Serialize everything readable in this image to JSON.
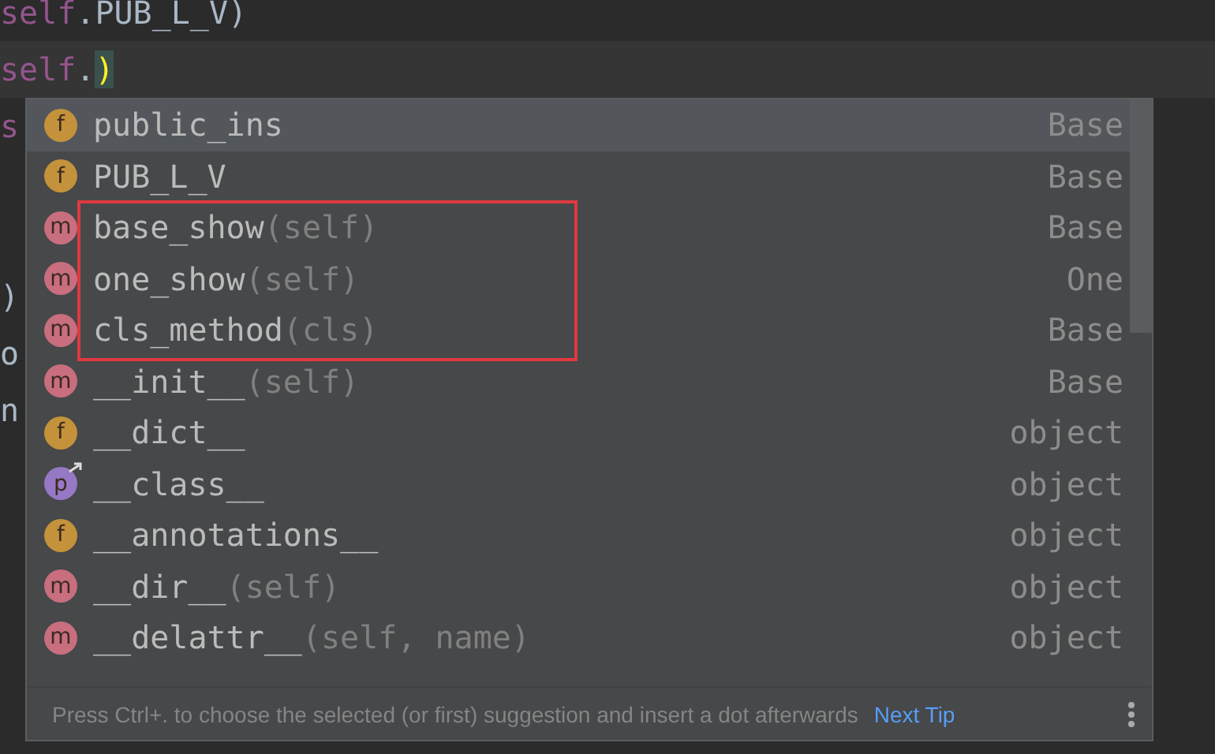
{
  "editor_lines": [
    {
      "segments": [
        {
          "kind": "keyword",
          "text": "self"
        },
        {
          "kind": "plain",
          "text": ".PUB_L_V)"
        }
      ]
    },
    {
      "current": true,
      "segments": [
        {
          "kind": "keyword",
          "text": "self"
        },
        {
          "kind": "plain",
          "text": "."
        },
        {
          "kind": "bracket",
          "text": ")"
        }
      ]
    },
    {
      "segments": [
        {
          "kind": "keyword",
          "text": "s"
        }
      ]
    },
    {
      "gap_before": true,
      "segments": [
        {
          "kind": "plain",
          "text": ")"
        }
      ]
    },
    {
      "segments": [
        {
          "kind": "plain",
          "text": "o"
        }
      ]
    },
    {
      "segments": [
        {
          "kind": "plain",
          "text": "n"
        }
      ]
    }
  ],
  "completion": {
    "items": [
      {
        "kind": "field",
        "badge": "f",
        "name": "public_ins",
        "type": "Base",
        "selected": true,
        "framed": false
      },
      {
        "kind": "field",
        "badge": "f",
        "name": "PUB_L_V",
        "type": "Base",
        "selected": false,
        "framed": false
      },
      {
        "kind": "method",
        "badge": "m",
        "name": "base_show",
        "params": "(self)",
        "type": "Base",
        "selected": false,
        "framed": true
      },
      {
        "kind": "method",
        "badge": "m",
        "name": "one_show",
        "params": "(self)",
        "type": "One",
        "selected": false,
        "framed": true
      },
      {
        "kind": "method",
        "badge": "m",
        "name": "cls_method",
        "params": "(cls)",
        "type": "Base",
        "selected": false,
        "framed": true
      },
      {
        "kind": "method",
        "badge": "m",
        "name": "__init__",
        "params": "(self)",
        "type": "Base",
        "selected": false,
        "framed": false
      },
      {
        "kind": "field",
        "badge": "f",
        "name": "__dict__",
        "type": "object",
        "selected": false,
        "framed": false
      },
      {
        "kind": "property",
        "badge": "p",
        "name": "__class__",
        "type": "object",
        "selected": false,
        "framed": false
      },
      {
        "kind": "field",
        "badge": "f",
        "name": "__annotations__",
        "type": "object",
        "selected": false,
        "framed": false
      },
      {
        "kind": "method",
        "badge": "m",
        "name": "__dir__",
        "params": "(self)",
        "type": "object",
        "selected": false,
        "framed": false
      },
      {
        "kind": "method",
        "badge": "m",
        "name": "__delattr__",
        "params": "(self, name)",
        "type": "object",
        "selected": false,
        "framed": false
      }
    ],
    "hint": "Press Ctrl+. to choose the selected (or first) suggestion and insert a dot afterwards",
    "next_tip": "Next Tip"
  }
}
